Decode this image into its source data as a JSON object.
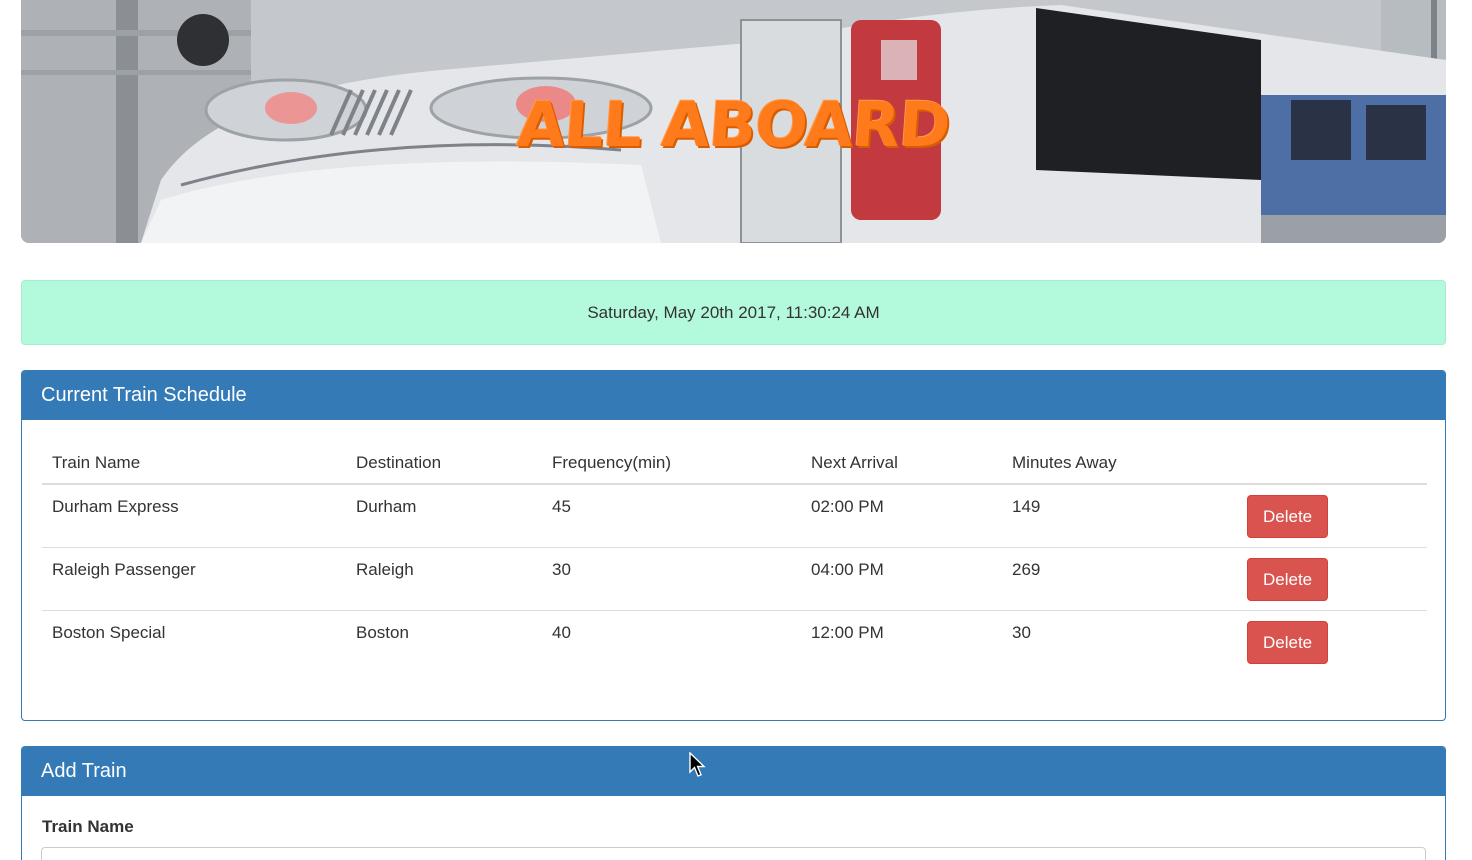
{
  "hero": {
    "title": "ALL ABOARD",
    "image_alt": "high-speed train photo"
  },
  "clock": {
    "text": "Saturday, May 20th 2017, 11:30:24 AM"
  },
  "schedule": {
    "heading": "Current Train Schedule",
    "columns": [
      "Train Name",
      "Destination",
      "Frequency(min)",
      "Next Arrival",
      "Minutes Away"
    ],
    "rows": [
      {
        "name": "Durham Express",
        "destination": "Durham",
        "frequency": "45",
        "next_arrival": "02:00 PM",
        "minutes_away": "149",
        "action": "Delete"
      },
      {
        "name": "Raleigh Passenger",
        "destination": "Raleigh",
        "frequency": "30",
        "next_arrival": "04:00 PM",
        "minutes_away": "269",
        "action": "Delete"
      },
      {
        "name": "Boston Special",
        "destination": "Boston",
        "frequency": "40",
        "next_arrival": "12:00 PM",
        "minutes_away": "30",
        "action": "Delete"
      }
    ]
  },
  "add_train": {
    "heading": "Add Train",
    "train_name_label": "Train Name",
    "train_name_value": "",
    "train_name_placeholder": ""
  },
  "colors": {
    "primary": "#337ab7",
    "danger": "#d9534f",
    "clock_bg": "#b3fadc",
    "title_orange": "#ff7a1a"
  }
}
